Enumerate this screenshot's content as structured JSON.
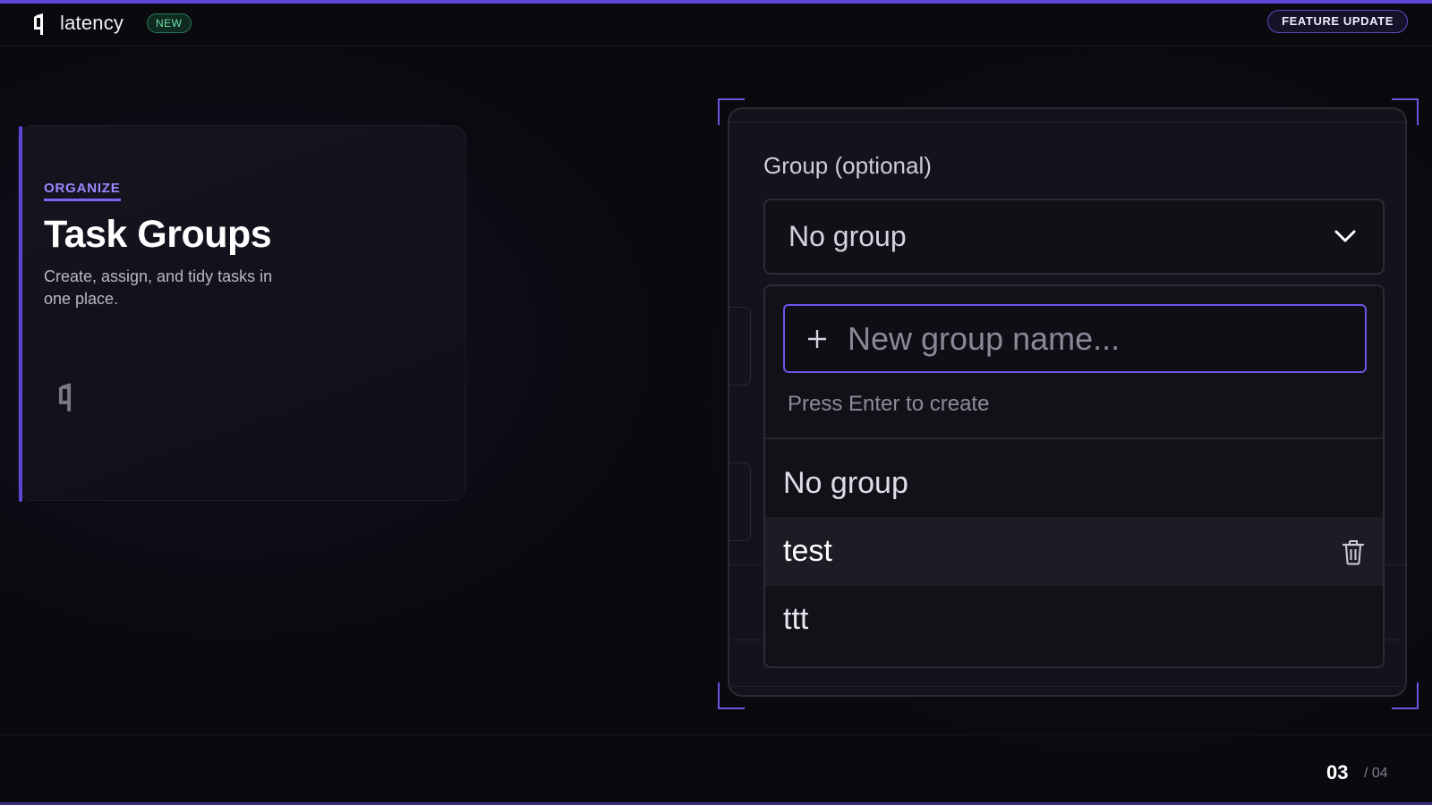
{
  "brand": {
    "name": "latency",
    "badge": "NEW",
    "logo_icon": "latency-logo-icon"
  },
  "header": {
    "feature_pill": "FEATURE UPDATE"
  },
  "card": {
    "eyebrow": "ORGANIZE",
    "title": "Task Groups",
    "description": "Create, assign, and tidy tasks in one place."
  },
  "form": {
    "group_label": "Group (optional)",
    "select_value": "No group",
    "new_group_placeholder": "New group name...",
    "hint": "Press Enter to create",
    "options": [
      "No group",
      "test",
      "ttt"
    ],
    "hovered_option": "test"
  },
  "pagination": {
    "current": "03",
    "total": "/ 04"
  },
  "colors": {
    "accent": "#5a46d6",
    "accent_light": "#9c88ff",
    "badge_green": "#6fe0a8",
    "background": "#0a090e"
  }
}
